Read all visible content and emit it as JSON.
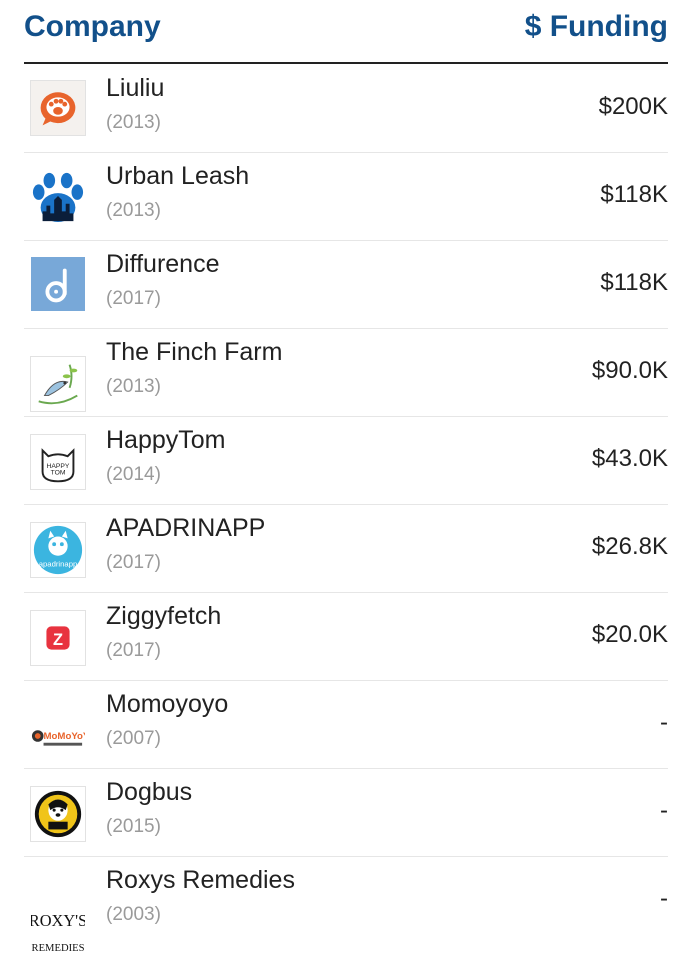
{
  "header": {
    "company_label": "Company",
    "funding_label": "$ Funding"
  },
  "rows": [
    {
      "name": "Liuliu",
      "year": "(2013)",
      "amount": "$200K",
      "logo_icon": "liuliu-logo-icon"
    },
    {
      "name": "Urban Leash",
      "year": "(2013)",
      "amount": "$118K",
      "logo_icon": "urban-leash-logo-icon"
    },
    {
      "name": "Diffurence",
      "year": "(2017)",
      "amount": "$118K",
      "logo_icon": "diffurence-logo-icon"
    },
    {
      "name": "The Finch Farm",
      "year": "(2013)",
      "amount": "$90.0K",
      "logo_icon": "finch-farm-logo-icon"
    },
    {
      "name": "HappyTom",
      "year": "(2014)",
      "amount": "$43.0K",
      "logo_icon": "happytom-logo-icon",
      "logo_text_1": "HAPPY",
      "logo_text_2": "TOM"
    },
    {
      "name": "APADRINAPP",
      "year": "(2017)",
      "amount": "$26.8K",
      "logo_icon": "apadrinapp-logo-icon",
      "logo_text": "apadrinapp"
    },
    {
      "name": "Ziggyfetch",
      "year": "(2017)",
      "amount": "$20.0K",
      "logo_icon": "ziggyfetch-logo-icon",
      "logo_text": "Z"
    },
    {
      "name": "Momoyoyo",
      "year": "(2007)",
      "amount": "-",
      "logo_icon": "momoyoyo-logo-icon",
      "logo_text": "MoMoYoYo"
    },
    {
      "name": "Dogbus",
      "year": "(2015)",
      "amount": "-",
      "logo_icon": "dogbus-logo-icon"
    },
    {
      "name": "Roxys Remedies",
      "year": "(2003)",
      "amount": "-",
      "logo_icon": "roxys-remedies-logo-icon",
      "logo_text_1": "ROXY'S",
      "logo_text_2": "REMEDIES"
    }
  ],
  "colors": {
    "header": "#12508a",
    "liuliu": "#e8642c",
    "urban_leash": "#1a73c8",
    "diffurence": "#78a8d8",
    "apadrinapp": "#3bb5e0",
    "ziggyfetch": "#e8333f",
    "dogbus": "#f0c419"
  }
}
